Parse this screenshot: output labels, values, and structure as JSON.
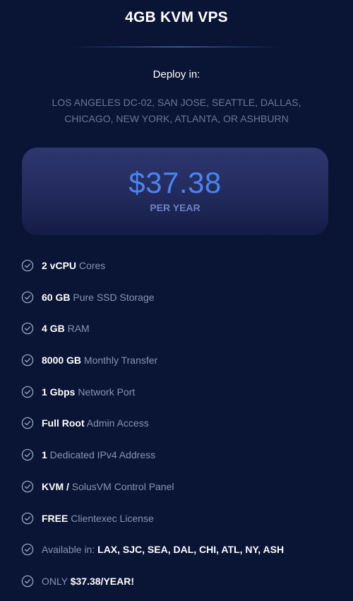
{
  "plan": {
    "title": "4GB KVM VPS",
    "deploy_label": "Deploy in:",
    "locations_line1": "LOS ANGELES DC-02, SAN JOSE, SEATTLE, DALLAS,",
    "locations_line2": "CHICAGO, NEW YORK, ATLANTA, OR ASHBURN"
  },
  "pricing": {
    "price": "$37.38",
    "period": "PER YEAR"
  },
  "features": [
    {
      "bold": "2 vCPU",
      "text": " Cores"
    },
    {
      "bold": "60 GB",
      "text": " Pure SSD Storage"
    },
    {
      "bold": "4 GB",
      "text": " RAM"
    },
    {
      "bold": "8000 GB",
      "text": " Monthly Transfer"
    },
    {
      "bold": "1 Gbps",
      "text": " Network Port"
    },
    {
      "bold": "Full Root",
      "text": " Admin Access"
    },
    {
      "bold": "1",
      "text": " Dedicated IPv4 Address"
    },
    {
      "bold": "KVM /",
      "text": " SolusVM Control Panel"
    },
    {
      "bold": "FREE",
      "text": " Clientexec License"
    },
    {
      "prefix": "Available in: ",
      "bold": "LAX, SJC, SEA, DAL, CHI, ATL, NY, ASH"
    },
    {
      "prefix": "ONLY ",
      "bold": "$37.38/YEAR!"
    }
  ],
  "icons": {
    "feature_check": "check-circle-icon"
  },
  "colors": {
    "background": "#0a1434",
    "price_accent": "#4a84ee",
    "muted_text": "#8a93b1"
  }
}
